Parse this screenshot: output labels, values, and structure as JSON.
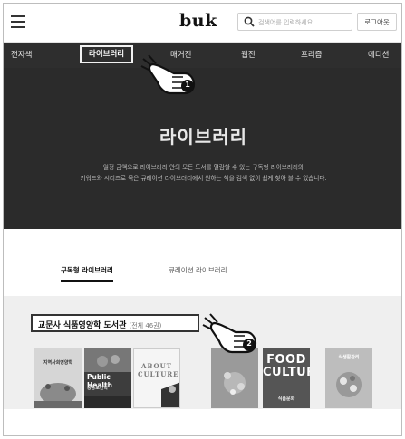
{
  "header": {
    "menu_icon": "hamburger-menu-icon",
    "logo": "buk",
    "search_placeholder": "검색어를 입력하세요",
    "search_icon": "search-icon",
    "login_label": "로그아웃"
  },
  "nav": {
    "items": [
      {
        "label": "전자책"
      },
      {
        "label": "라이브러리",
        "active": true
      },
      {
        "label": "매거진"
      },
      {
        "label": "웹진"
      },
      {
        "label": "프리즘"
      },
      {
        "label": "에디션"
      }
    ]
  },
  "hero": {
    "title": "라이브러리",
    "desc_line1": "일정 금액으로 라이브러리 안의 모든 도서를 열람할 수 있는 구독형 라이브러리와",
    "desc_line2": "키워드와 시리즈로 묶은 큐레이션 라이브러리에서 원하는 책을 검색 없이 쉽게 찾아 볼 수 있습니다."
  },
  "tabs": [
    {
      "label": "구독형 라이브러리",
      "active": true
    },
    {
      "label": "큐레이션 라이브러리",
      "active": false
    }
  ],
  "collection": {
    "title": "교문사 식품영양학 도서관",
    "count": "(전체 46권)",
    "books": [
      {
        "title": "지역사회영양학"
      },
      {
        "title": "Public Health",
        "subtitle": "공중보건학"
      },
      {
        "title": "ABOUT CULTURE"
      },
      {
        "title": ""
      },
      {
        "title": "FOOD CULTURE",
        "subtitle": "식품문화"
      },
      {
        "title": "식생활관리"
      }
    ]
  },
  "annotations": [
    {
      "badge": "1",
      "icon": "pointing-hand-icon"
    },
    {
      "badge": "2",
      "icon": "pointing-hand-icon"
    }
  ],
  "colors": {
    "nav_bg": "#2e2e2e",
    "hero_bg": "#2b2b2b",
    "collection_bg": "#efefef"
  }
}
